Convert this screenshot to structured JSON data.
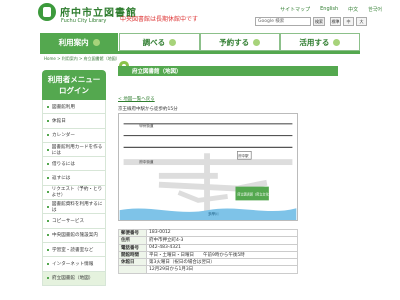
{
  "header": {
    "site_title": "府中市立図書館",
    "site_subtitle": "Fuchu City Library",
    "notice": "中央図書館は長期休館中です",
    "links": [
      "サイトマップ",
      "English",
      "中文",
      "한국어"
    ],
    "search_placeholder": "Google 検索",
    "search_button": "検索",
    "font_sizes": [
      "標準",
      "中",
      "大"
    ]
  },
  "nav": {
    "tabs": [
      {
        "label": "利用案内",
        "active": true
      },
      {
        "label": "調べる",
        "active": false
      },
      {
        "label": "予約する",
        "active": false
      },
      {
        "label": "活用する",
        "active": false
      }
    ]
  },
  "breadcrumb": "Home > 利用案内 > 府立図書館（地図）",
  "sidebar": {
    "heading_line1": "利用者メニュー",
    "heading_line2": "ログイン",
    "items": [
      "図書館利用",
      "休館日",
      "カレンダー",
      "図書館利用カードを作るには",
      "借りるには",
      "返すには",
      "リクエスト（予約・とりよせ）",
      "図書館資料を利用するには",
      "コピーサービス",
      "中央図書館の施設案内",
      "学習室・読書室など",
      "インターネット情報",
      "府立図書館（地図）"
    ],
    "active_index": 12
  },
  "main": {
    "title": "府立図書館（地図）",
    "back_link": "< 地図一覧へ戻る",
    "map_caption": "京王線府中駅から徒歩約15分",
    "map_labels": {
      "top_road": "甲州街道",
      "middle_road": "府中街道",
      "station": "府中駅",
      "library": "府立図書館（府立文化センター3階）",
      "river": "多摩川"
    }
  },
  "info_table": [
    {
      "key": "郵便番号",
      "value": "183-0012"
    },
    {
      "key": "住所",
      "value": "府中市押立町4-3"
    },
    {
      "key": "電話番号",
      "value": "042-483-4321"
    },
    {
      "key": "開館時間",
      "value": "平日・土曜日・日曜日　　午前9時から午後5時"
    },
    {
      "key": "休館日",
      "value": "第3火曜日（祝日の場合は翌日）"
    },
    {
      "key": "",
      "value": "12月29日から1月3日"
    }
  ],
  "colors": {
    "brand_green": "#54a84f",
    "notice_red": "#d33333"
  }
}
